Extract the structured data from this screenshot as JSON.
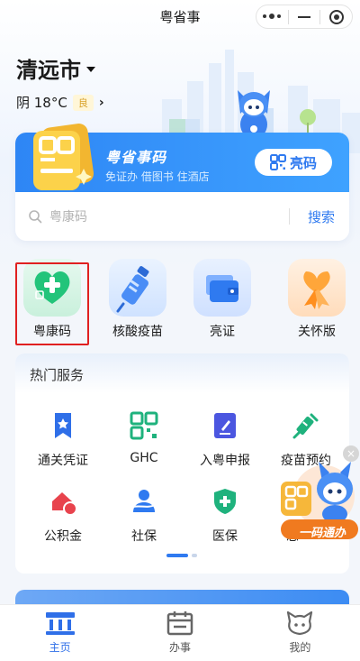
{
  "title_bar": {
    "title": "粤省事",
    "more_icon": "more-dots-icon",
    "minimize_icon": "minimize-icon",
    "close_icon": "target-circle-icon"
  },
  "header": {
    "city": "清远市",
    "weather": "阴 18°C",
    "air_quality": "良",
    "arrow": "›"
  },
  "code_card": {
    "title": "粤省事码",
    "subtitle": "免证办 借图书 住酒店",
    "button_label": "亮码",
    "search_placeholder": "粤康码",
    "search_button": "搜索"
  },
  "quick_entries": [
    {
      "label": "粤康码",
      "icon": "health-heart-icon"
    },
    {
      "label": "核酸疫苗",
      "icon": "syringe-icon"
    },
    {
      "label": "亮证",
      "icon": "wallet-icon"
    },
    {
      "label": "关怀版",
      "icon": "ribbon-icon"
    }
  ],
  "hot_services": {
    "title": "热门服务",
    "items": [
      {
        "label": "通关凭证",
        "icon": "pass-badge-icon"
      },
      {
        "label": "GHC",
        "icon": "ghc-qr-icon"
      },
      {
        "label": "入粤申报",
        "icon": "report-edit-icon"
      },
      {
        "label": "疫苗预约",
        "icon": "vaccine-icon"
      },
      {
        "label": "公积金",
        "icon": "house-fund-icon"
      },
      {
        "label": "社保",
        "icon": "social-security-icon"
      },
      {
        "label": "医保",
        "icon": "medical-insurance-icon"
      },
      {
        "label": "志",
        "icon": "volunteer-icon"
      }
    ]
  },
  "promo": {
    "label": "一码通办",
    "close": "×"
  },
  "tabbar": [
    {
      "label": "主页",
      "icon": "home-icon",
      "active": true
    },
    {
      "label": "办事",
      "icon": "calendar-icon",
      "active": false
    },
    {
      "label": "我的",
      "icon": "mascot-face-icon",
      "active": false
    }
  ],
  "colors": {
    "brand_blue": "#2f7af0",
    "highlight_red": "#e02020",
    "health_green": "#22c47a"
  }
}
